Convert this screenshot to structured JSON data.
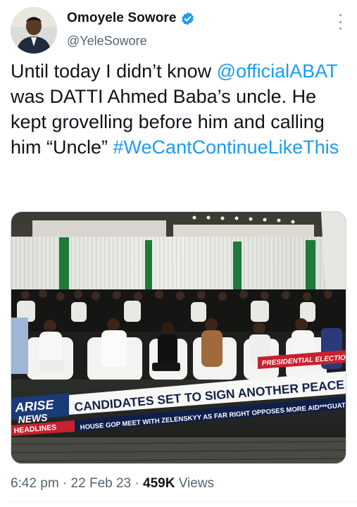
{
  "author": {
    "display_name": "Omoyele Sowore",
    "handle": "@YeleSowore",
    "verified": true,
    "avatar_icon": "profile-photo"
  },
  "tweet": {
    "text_part1": "Until today I didn’t know ",
    "mention": "@officialABAT",
    "text_part2": " was DATTI Ahmed Baba’s uncle. He kept grovelling before him and calling him “Uncle” ",
    "hashtag": "#WeCantContinueLikeThis"
  },
  "media": {
    "overlay": {
      "tag": "PRESIDENTIAL ELECTION",
      "headline": "CANDIDATES SET TO SIGN ANOTHER PEACE ACCORD",
      "brand_top": "ARISE",
      "brand_bottom": "NEWS",
      "section": "HEADLINES",
      "ticker": "HOUSE GOP MEET WITH ZELENSKYY AS FAR RIGHT OPPOSES MORE AID***GUATEMAL"
    }
  },
  "meta": {
    "time": "6:42 pm",
    "separator": "·",
    "date": "22 Feb 23",
    "views_count": "459K",
    "views_label": "Views"
  },
  "colors": {
    "accent": "#1d9bf0",
    "secondary_text": "#536471",
    "ticker_red": "#c8202e",
    "ticker_blue": "#1b3a78"
  }
}
